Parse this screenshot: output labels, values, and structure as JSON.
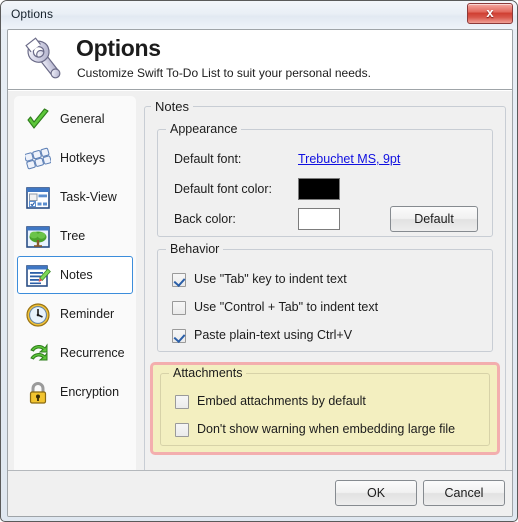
{
  "window": {
    "title": "Options",
    "close_label": "x"
  },
  "banner": {
    "icon": "wrench-icon",
    "title": "Options",
    "subtitle": "Customize Swift To-Do List to suit your personal needs."
  },
  "sidebar": {
    "items": [
      {
        "id": "general",
        "label": "General",
        "icon": "green-check-icon",
        "selected": false
      },
      {
        "id": "hotkeys",
        "label": "Hotkeys",
        "icon": "keyboard-keys-icon",
        "selected": false
      },
      {
        "id": "task-view",
        "label": "Task-View",
        "icon": "task-view-icon",
        "selected": false
      },
      {
        "id": "tree",
        "label": "Tree",
        "icon": "tree-icon",
        "selected": false
      },
      {
        "id": "notes",
        "label": "Notes",
        "icon": "notes-pencil-icon",
        "selected": true
      },
      {
        "id": "reminder",
        "label": "Reminder",
        "icon": "clock-icon",
        "selected": false
      },
      {
        "id": "recurrence",
        "label": "Recurrence",
        "icon": "recycle-arrows-icon",
        "selected": false
      },
      {
        "id": "encryption",
        "label": "Encryption",
        "icon": "padlock-icon",
        "selected": false
      }
    ]
  },
  "main": {
    "group_title": "Notes",
    "appearance": {
      "title": "Appearance",
      "default_font_label": "Default font:",
      "default_font_value": "Trebuchet MS, 9pt",
      "default_font_color_label": "Default font color:",
      "default_font_color_value": "#000000",
      "back_color_label": "Back color:",
      "back_color_value": "#ffffff",
      "default_button": "Default"
    },
    "behavior": {
      "title": "Behavior",
      "checkboxes": [
        {
          "id": "tab-indent",
          "label": "Use \"Tab\" key to indent text",
          "checked": true
        },
        {
          "id": "ctrl-tab-indent",
          "label": "Use \"Control + Tab\" to indent text",
          "checked": false
        },
        {
          "id": "paste-plain",
          "label": "Paste plain-text using Ctrl+V",
          "checked": true
        }
      ]
    },
    "attachments": {
      "title": "Attachments",
      "highlighted": true,
      "highlight_border_color": "#f3aeae",
      "highlight_fill_color": "#f3efc0",
      "checkboxes": [
        {
          "id": "embed-default",
          "label": "Embed attachments by default",
          "checked": false
        },
        {
          "id": "no-warn-large",
          "label": "Don't show warning when embedding large file",
          "checked": false
        }
      ]
    }
  },
  "footer": {
    "ok_label": "OK",
    "cancel_label": "Cancel"
  },
  "colors": {
    "selection_border": "#3c8ddb",
    "link": "#1010e0",
    "close_button": "#cf3f32"
  }
}
